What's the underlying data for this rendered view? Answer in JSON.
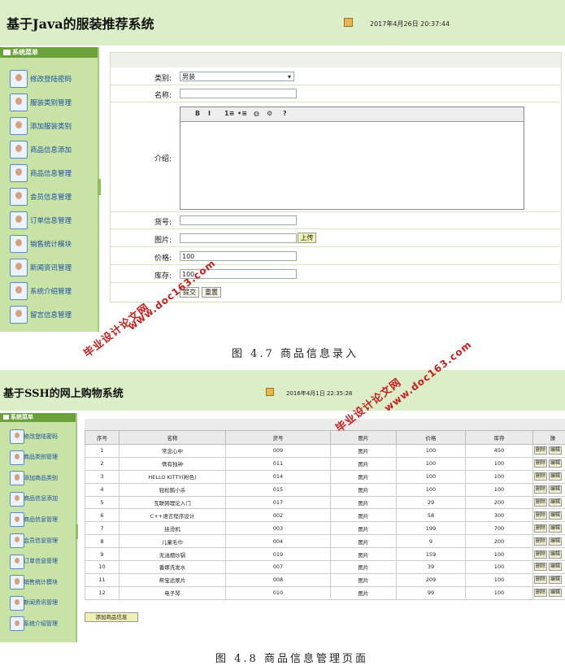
{
  "shot1": {
    "title": "基于Java的服装推荐系统",
    "datetime": "2017年4月26日  20:37:44",
    "menu_header": "系统菜单",
    "menu": [
      "修改登陆密码",
      "服装类别管理",
      "添加服装类别",
      "商品信息添加",
      "商品信息管理",
      "会员信息管理",
      "订单信息管理",
      "销售统计模块",
      "新闻资讯管理",
      "系统介绍管理",
      "留言信息管理"
    ],
    "form": {
      "category_label": "类别:",
      "category_value": "男装",
      "name_label": "名称:",
      "intro_label": "介绍:",
      "editor_tools": [
        "B",
        "I",
        "1≡",
        "•≡",
        "◍",
        "⚙",
        "?"
      ],
      "code_label": "货号:",
      "image_label": "图片:",
      "upload_button": "上传",
      "price_label": "价格:",
      "price_value": "100",
      "stock_label": "库存:",
      "stock_value": "100",
      "submit_button": "提交",
      "reset_button": "重置"
    },
    "caption": "图 4.7 商品信息录入"
  },
  "shot2": {
    "title": "基于SSH的网上购物系统",
    "datetime": "2016年4月1日  22:35:28",
    "menu_header": "系统菜单",
    "menu": [
      "修改登陆密码",
      "商品类别管理",
      "添加商品类别",
      "商品信息添加",
      "商品信息管理",
      "会员信息管理",
      "订单信息管理",
      "销售统计模块",
      "新闻资讯管理",
      "系统介绍管理"
    ],
    "table": {
      "headers": [
        "序号",
        "名称",
        "货号",
        "图片",
        "价格",
        "库存",
        "操"
      ],
      "rows": [
        [
          "1",
          "常念心中",
          "009",
          "图片",
          "100",
          "450"
        ],
        [
          "2",
          "情有独钟",
          "011",
          "图片",
          "100",
          "100"
        ],
        [
          "3",
          "HELLO KITTY(粉色)",
          "014",
          "图片",
          "100",
          "100"
        ],
        [
          "4",
          "轻松鹅小杀",
          "015",
          "图片",
          "100",
          "100"
        ],
        [
          "5",
          "互联网理论入门",
          "017",
          "图片",
          "29",
          "200"
        ],
        [
          "6",
          "C++语言程序设计",
          "002",
          "图片",
          "58",
          "300"
        ],
        [
          "7",
          "挂烫机",
          "003",
          "图片",
          "199",
          "700"
        ],
        [
          "8",
          "儿童毛巾",
          "004",
          "图片",
          "9",
          "200"
        ],
        [
          "9",
          "无油烟炒锅",
          "019",
          "图片",
          "159",
          "100"
        ],
        [
          "10",
          "番娜洗发水",
          "007",
          "图片",
          "39",
          "100"
        ],
        [
          "11",
          "帮宝适尿片",
          "008",
          "图片",
          "209",
          "100"
        ],
        [
          "12",
          "电子琴",
          "010",
          "图片",
          "99",
          "100"
        ]
      ],
      "delete_label": "删除",
      "edit_label": "编辑"
    },
    "add_button": "添加商品信息",
    "caption": "图 4.8 商品信息管理页面"
  },
  "watermark": {
    "line1": "毕业设计论文网",
    "line2": "www.doc163.com",
    "color": "#c81e1e"
  }
}
